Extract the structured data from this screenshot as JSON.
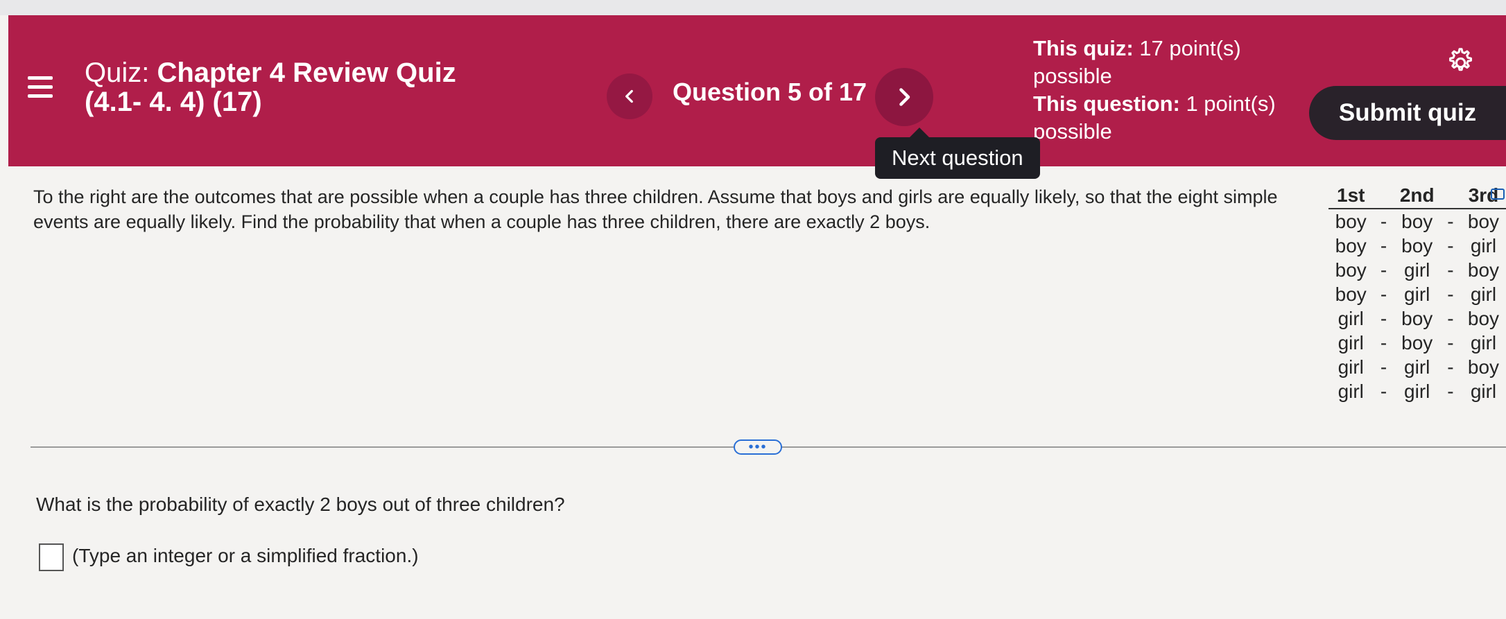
{
  "header": {
    "quiz_label": "Quiz:",
    "quiz_title": "Chapter 4 Review Quiz",
    "quiz_subtitle": "(4.1- 4. 4) (17)",
    "question_counter": "Question 5 of 17",
    "next_tooltip": "Next question",
    "this_quiz_label": "This quiz:",
    "this_quiz_value": "17 point(s) possible",
    "this_question_label": "This question:",
    "this_question_value": "1 point(s) possible",
    "submit_label": "Submit quiz",
    "accent_color": "#b01e4a",
    "icons": [
      "menu-icon",
      "chevron-left-icon",
      "chevron-right-icon",
      "gear-icon"
    ]
  },
  "problem": {
    "prompt": "To the right are the outcomes that are possible when a couple has three children. Assume that boys and girls are equally likely, so that the eight simple events are equally likely. Find the probability that when a couple has three children, there are exactly 2 boys.",
    "table": {
      "headers": [
        "1st",
        "2nd",
        "3rd"
      ],
      "rows": [
        [
          "boy",
          "boy",
          "boy"
        ],
        [
          "boy",
          "boy",
          "girl"
        ],
        [
          "boy",
          "girl",
          "boy"
        ],
        [
          "boy",
          "girl",
          "girl"
        ],
        [
          "girl",
          "boy",
          "boy"
        ],
        [
          "girl",
          "boy",
          "girl"
        ],
        [
          "girl",
          "girl",
          "boy"
        ],
        [
          "girl",
          "girl",
          "girl"
        ]
      ]
    },
    "expand_label": "•••"
  },
  "answer": {
    "question": "What is the probability of exactly 2 boys out of three children?",
    "value": "",
    "hint": "(Type an integer or a simplified fraction.)"
  }
}
